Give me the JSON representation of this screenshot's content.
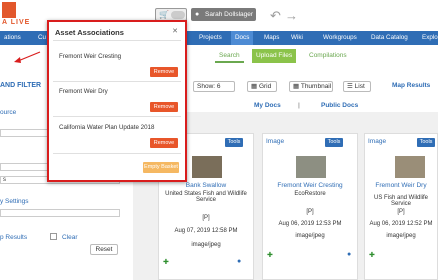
{
  "logo": {
    "text": "A LIVE"
  },
  "header": {
    "user_name": "Sarah Dollslager",
    "user_icon": "user-icon",
    "cart_icon": "cart-icon"
  },
  "nav": {
    "items": [
      {
        "label": "ations",
        "active": false
      },
      {
        "label": "Cu",
        "active": false
      },
      {
        "label": "Projects",
        "active": false
      },
      {
        "label": "Docs",
        "active": true
      },
      {
        "label": "Maps",
        "active": false
      },
      {
        "label": "Wiki",
        "active": false
      },
      {
        "label": "Workgroups",
        "active": false
      },
      {
        "label": "Data Catalog",
        "active": false
      },
      {
        "label": "Explore",
        "active": false
      }
    ]
  },
  "subtabs": {
    "search": "Search",
    "upload": "Upload Files",
    "compilations": "Compilations"
  },
  "sidebar": {
    "title": "AND FILTER",
    "source_label": "ource",
    "field_a": "",
    "field_b": "",
    "field_c": "s",
    "settings_label": "y Settings",
    "results_label": "p Results",
    "clear_label": "Clear",
    "reset_label": "Reset"
  },
  "toolbar": {
    "show_label": "Show: 6",
    "grid_label": "Grid",
    "thumbnail_label": "Thumbnail",
    "list_label": "List",
    "map_results": "Map Results"
  },
  "docs_tabs": {
    "my_docs": "My Docs",
    "separator": "|",
    "public_docs": "Public Docs"
  },
  "cards": [
    {
      "type": "",
      "tools": "Tools",
      "title": "Bank Swallow",
      "org": "United States Fish and Wildlife Service",
      "p": "[P]",
      "date": "Aug 07, 2019 12:58 PM",
      "mime": "image/jpeg"
    },
    {
      "type": "Image",
      "tools": "Tools",
      "title": "Fremont Weir Cresting",
      "org": "EcoRestore",
      "p": "[P]",
      "date": "Aug 06, 2019 12:53 PM",
      "mime": "image/jpeg"
    },
    {
      "type": "Image",
      "tools": "Tools",
      "title": "Fremont Weir Dry",
      "org": "US Fish and Wildlife Service",
      "p": "[P]",
      "date": "Aug 06, 2019 12:52 PM",
      "mime": "image/jpeg"
    }
  ],
  "popup": {
    "title": "Asset Associations",
    "close_icon": "close-icon",
    "items": [
      {
        "name": "Fremont Weir Cresting",
        "remove": "Remove"
      },
      {
        "name": "Fremont Weir Dry",
        "remove": "Remove"
      },
      {
        "name": "California Water Plan Update 2018",
        "remove": "Remove"
      }
    ],
    "empty_label": "Empty Basket"
  },
  "colors": {
    "nav": "#2f6db5",
    "highlight": "#d91d1d",
    "remove": "#e8562a",
    "empty": "#f5b862",
    "green": "#8bc34a"
  }
}
